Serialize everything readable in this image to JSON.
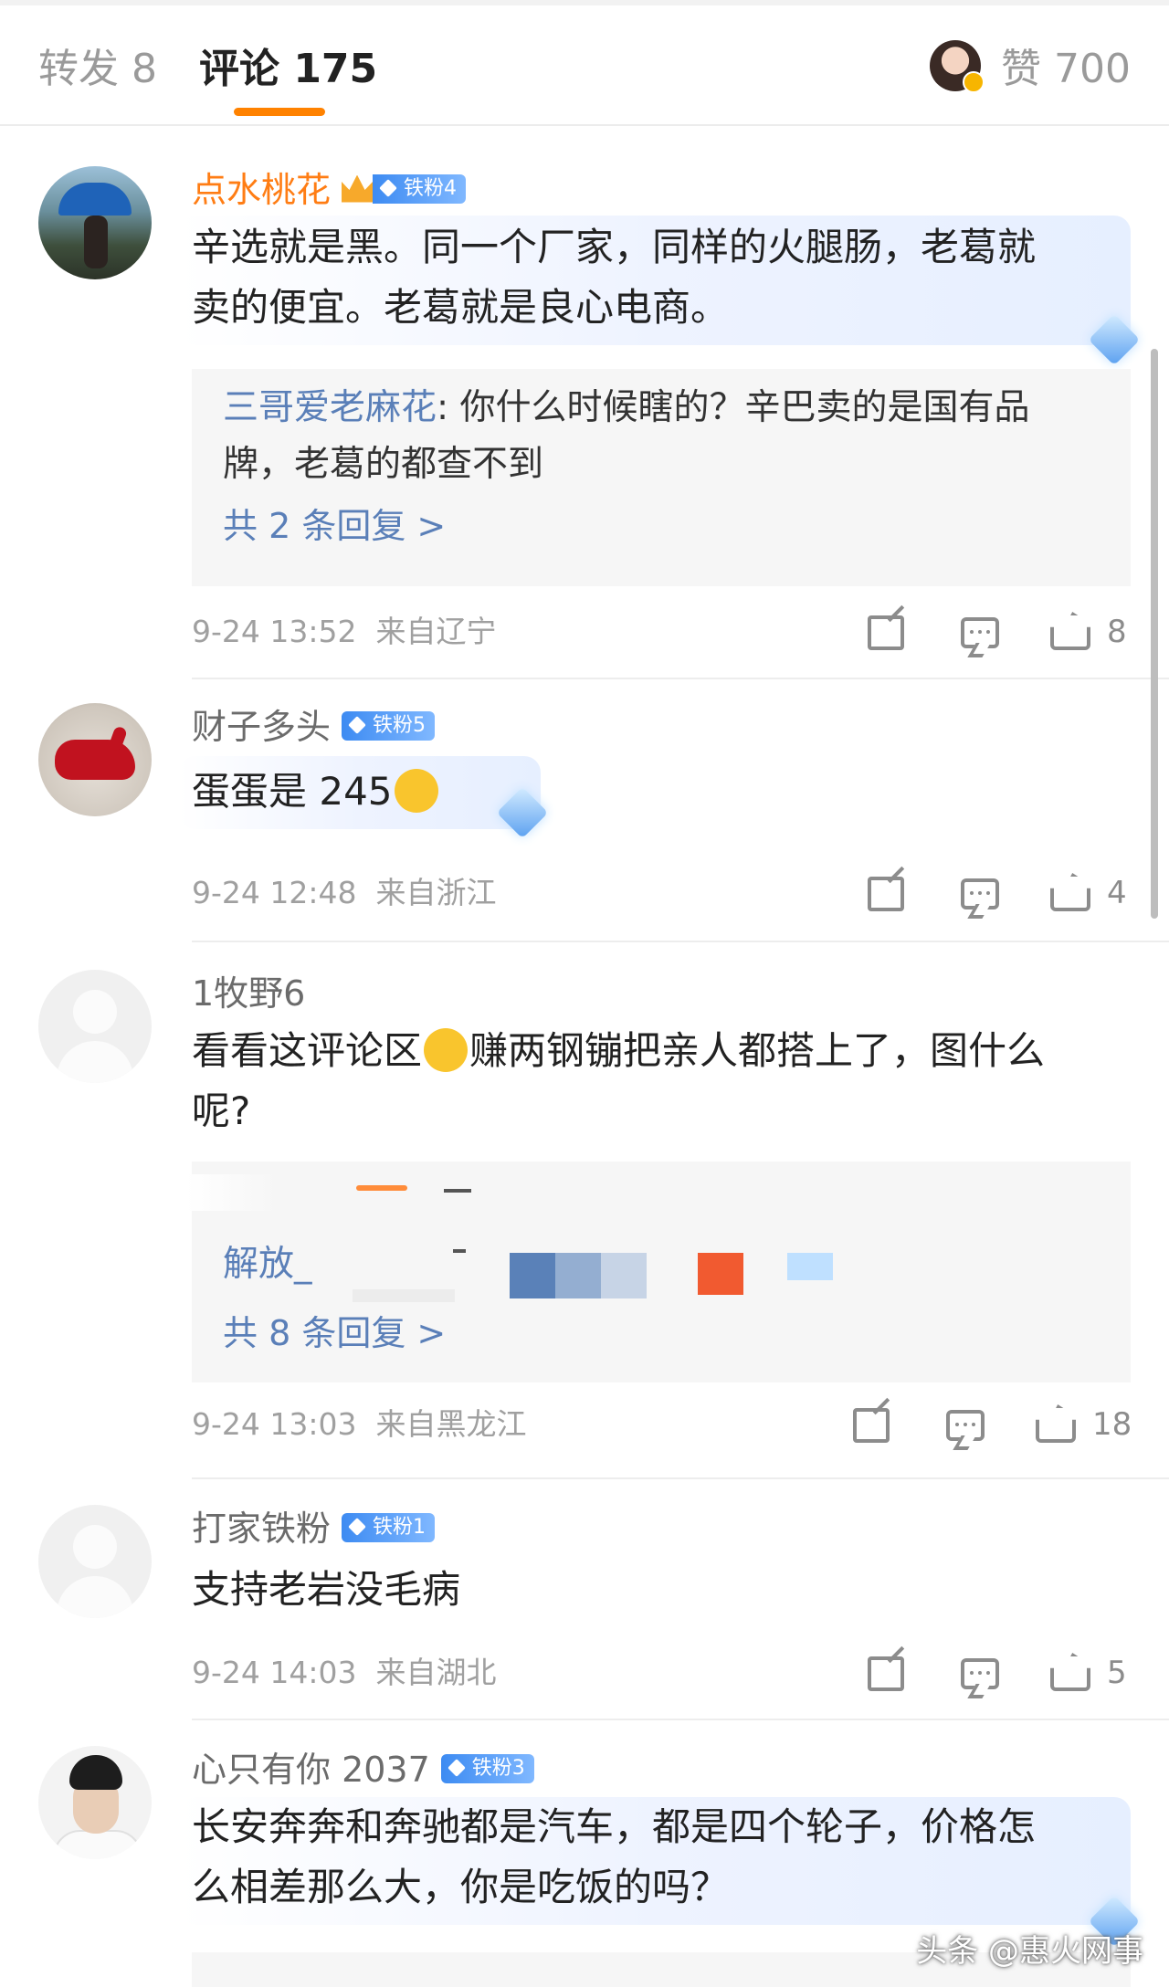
{
  "header": {
    "repost_tab": "转发 8",
    "comments_tab": "评论 175",
    "likes_tab": "赞 700",
    "accent": "#ff8200"
  },
  "comments": [
    {
      "user": "点水桃花",
      "badge": "铁粉4",
      "text_lines": [
        "辛选就是黑。同一个厂家，同样的火腿肠，老葛就",
        "卖的便宜。老葛就是良心电商。"
      ],
      "reply": {
        "user": "三哥爱老麻花",
        "text_line1": ": 你什么时候瞎的？辛巴卖的是国有品",
        "text_line2": "牌，老葛的都查不到",
        "count": "共 2 条回复 >"
      },
      "time": "9-24 13:52",
      "location": "来自辽宁",
      "likes": "8"
    },
    {
      "user": "财子多头",
      "badge": "铁粉5",
      "text": "蛋蛋是 245",
      "time": "9-24 12:48",
      "location": "来自浙江",
      "likes": "4"
    },
    {
      "user": "1牧野6",
      "text_line1_a": "看看这评论区",
      "text_line1_b": "赚两钢镚把亲人都搭上了，图什么",
      "text_line2": "呢?",
      "reply": {
        "user": "解放_",
        "count": "共 8 条回复 >"
      },
      "time": "9-24 13:03",
      "location": "来自黑龙江",
      "likes": "18"
    },
    {
      "user": "打家铁粉",
      "badge": "铁粉1",
      "text": "支持老岩没毛病",
      "time": "9-24 14:03",
      "location": "来自湖北",
      "likes": "5"
    },
    {
      "user": "心只有你 2037",
      "badge": "铁粉3",
      "text_lines": [
        "长安奔奔和奔驰都是汽车，都是四个轮子，价格怎",
        "么相差那么大，你是吃饭的吗？"
      ]
    }
  ],
  "watermark": "头条 @惠火网事"
}
